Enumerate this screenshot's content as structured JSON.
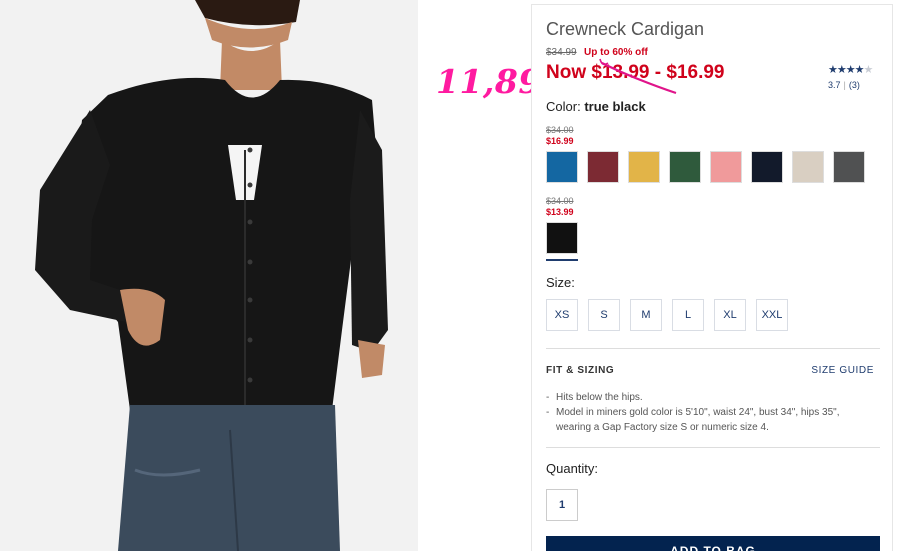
{
  "product": {
    "title": "Crewneck Cardigan",
    "original_price": "$34.99",
    "promo": "Up to 60% off",
    "now_price": "Now $13.99 - $16.99",
    "rating_value": "3.7",
    "rating_separator": "|",
    "review_count": "(3)",
    "rating_stars": 3.7
  },
  "annotation": {
    "handwritten_price": "11,89"
  },
  "color": {
    "label": "Color:",
    "selected": "true black",
    "groups": [
      {
        "was": "$34.00",
        "now": "$16.99",
        "swatches": [
          {
            "name": "teal blue",
            "hex": "#1467a2"
          },
          {
            "name": "burgundy",
            "hex": "#7c2a33"
          },
          {
            "name": "mustard",
            "hex": "#e2b448"
          },
          {
            "name": "forest green",
            "hex": "#2f5a3c"
          },
          {
            "name": "pink",
            "hex": "#f09a9b"
          },
          {
            "name": "navy",
            "hex": "#121a2b"
          },
          {
            "name": "oatmeal",
            "hex": "#d9cfc2"
          },
          {
            "name": "charcoal",
            "hex": "#505152"
          }
        ]
      },
      {
        "was": "$34.00",
        "now": "$13.99",
        "swatches": [
          {
            "name": "true black",
            "hex": "#111111"
          }
        ]
      }
    ]
  },
  "size": {
    "label": "Size:",
    "options": [
      "XS",
      "S",
      "M",
      "L",
      "XL",
      "XXL"
    ]
  },
  "fit": {
    "title": "FIT & SIZING",
    "guide_link": "SIZE GUIDE",
    "bullets": [
      "Hits below the hips.",
      "Model in miners gold color is 5'10\", waist 24\", bust 34\", hips 35\", wearing a Gap Factory size S or numeric size 4."
    ]
  },
  "quantity": {
    "label": "Quantity:",
    "value": "1"
  },
  "cta": {
    "add_to_bag": "ADD TO BAG"
  },
  "colors": {
    "sale_red": "#d0021b",
    "link_blue": "#1f3c6e",
    "button_navy": "#03234f",
    "annotation_pink": "#ff1aa0"
  }
}
